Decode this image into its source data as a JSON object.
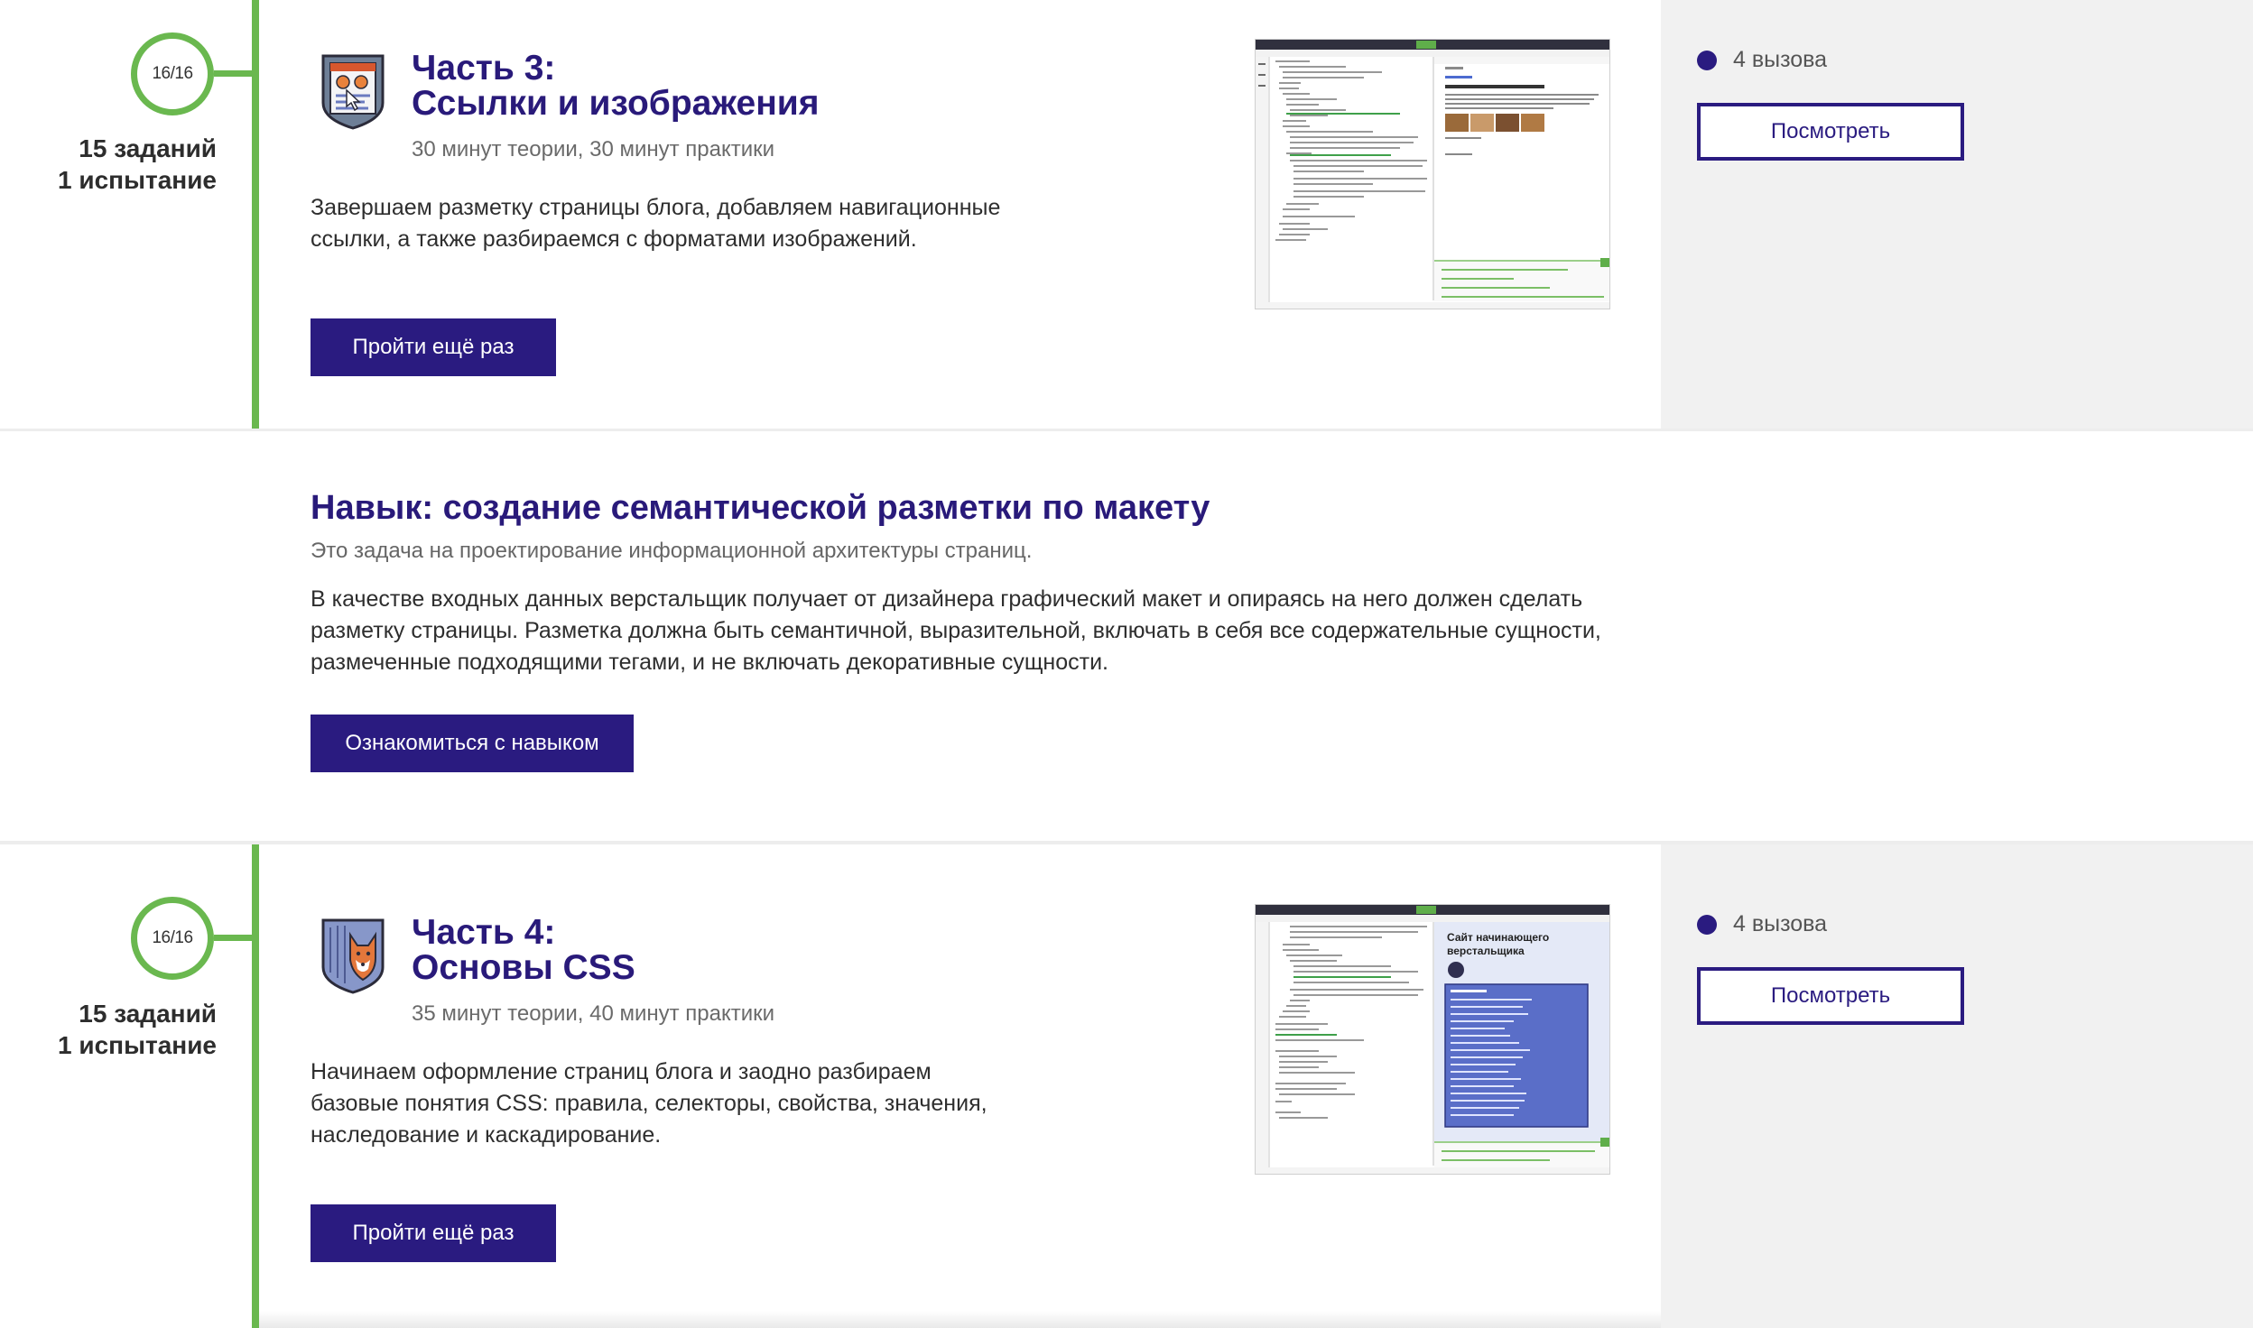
{
  "parts": [
    {
      "progress": "16/16",
      "stats_line1": "15 заданий",
      "stats_line2": "1 испытание",
      "title_line1": "Часть 3:",
      "title_line2": "Ссылки и изображения",
      "meta": "30 минут теории, 30 минут практики",
      "desc_line1": "Завершаем разметку страницы блога, добавляем навигационные",
      "desc_line2": "ссылки, а также разбираемся с форматами изображений.",
      "button": "Пройти ещё раз",
      "calls": "4 вызова",
      "view_button": "Посмотреть",
      "badge_icon": "page-badge-icon"
    },
    {
      "progress": "16/16",
      "stats_line1": "15 заданий",
      "stats_line2": "1 испытание",
      "title_line1": "Часть 4:",
      "title_line2": "Основы CSS",
      "meta": "35 минут теории, 40 минут практики",
      "desc_line1": "Начинаем оформление страниц блога и заодно разбираем",
      "desc_line2": "базовые понятия CSS: правила, селекторы, свойства, значения,",
      "desc_line3": "наследование и каскадирование.",
      "button": "Пройти ещё раз",
      "calls": "4 вызова",
      "view_button": "Посмотреть",
      "badge_icon": "fox-badge-icon",
      "preview_title_line1": "Сайт начинающего",
      "preview_title_line2": "верстальщика"
    }
  ],
  "skill": {
    "title": "Навык: создание семантической разметки по макету",
    "subtitle": "Это задача на проектирование информационной архитектуры страниц.",
    "desc_line1": "В качестве входных данных верстальщик получает от дизайнера графический макет и опираясь на него должен сделать",
    "desc_line2": "разметку страницы. Разметка должна быть семантичной, выразительной, включать в себя все содержательные сущности,",
    "desc_line3": "размеченные подходящими тегами, и не включать декоративные сущности.",
    "button": "Ознакомиться с навыком"
  },
  "colors": {
    "accent": "#2a1b80",
    "progress_green": "#6ab84f",
    "aside_bg": "#f1f1f1"
  }
}
